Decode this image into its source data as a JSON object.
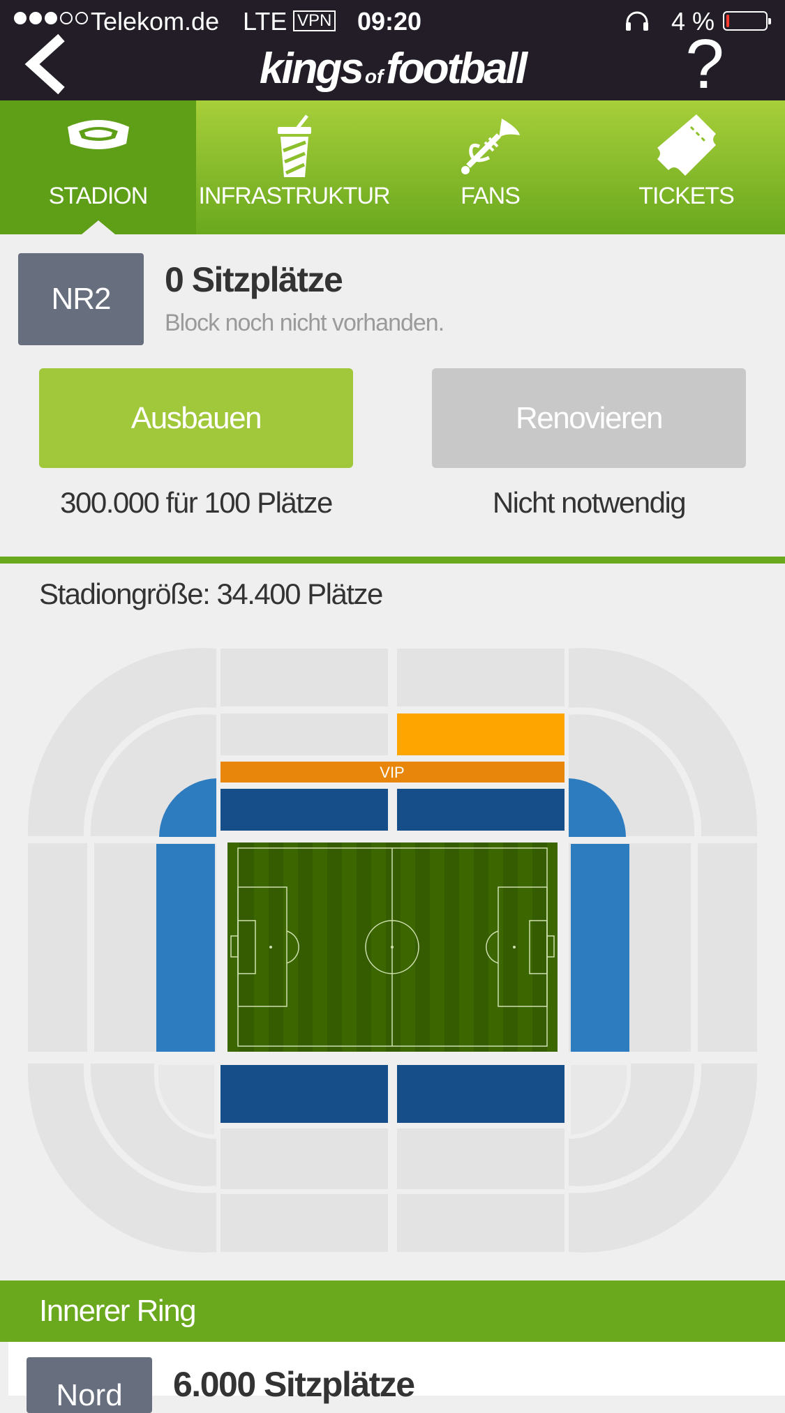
{
  "status_bar": {
    "signal_dots": [
      true,
      true,
      true,
      false,
      false
    ],
    "carrier": "Telekom.de",
    "network": "LTE",
    "vpn": "VPN",
    "time": "09:20",
    "battery_percent": "4 %",
    "battery_level": 0.04,
    "battery_color": "#ff3b30"
  },
  "header": {
    "logo_part1": "kings",
    "logo_of": "of",
    "logo_part2": "football",
    "help_label": "?",
    "back_icon": "chevron-left-icon"
  },
  "tabs": [
    {
      "label": "STADION",
      "icon": "stadium-icon",
      "active": true
    },
    {
      "label": "INFRASTRUKTUR",
      "icon": "drink-cup-icon",
      "active": false
    },
    {
      "label": "FANS",
      "icon": "trumpet-icon",
      "active": false
    },
    {
      "label": "TICKETS",
      "icon": "ticket-icon",
      "active": false
    }
  ],
  "block": {
    "code": "NR2",
    "seats": "0 Sitzplätze",
    "status": "Block noch nicht vorhanden."
  },
  "actions": {
    "upgrade_label": "Ausbauen",
    "upgrade_caption": "300.000 für 100 Plätze",
    "renovate_label": "Renovieren",
    "renovate_caption": "Nicht notwendig"
  },
  "stadium": {
    "size_text": "Stadiongröße: 34.400 Plätze",
    "vip_label": "VIP",
    "colors": {
      "empty": "#e3e3e3",
      "selected": "#ffa500",
      "vip": "#e8860c",
      "inner_dark": "#154e88",
      "inner_light": "#2d7cc0",
      "pitch": "#3b6600"
    }
  },
  "section": {
    "title": "Innerer Ring",
    "next_badge": "Nord",
    "next_seats": "6.000 Sitzplätze"
  },
  "brand": {
    "green": "#6aa81e",
    "light_green": "#a1c83b",
    "header_bg": "#221d27"
  }
}
